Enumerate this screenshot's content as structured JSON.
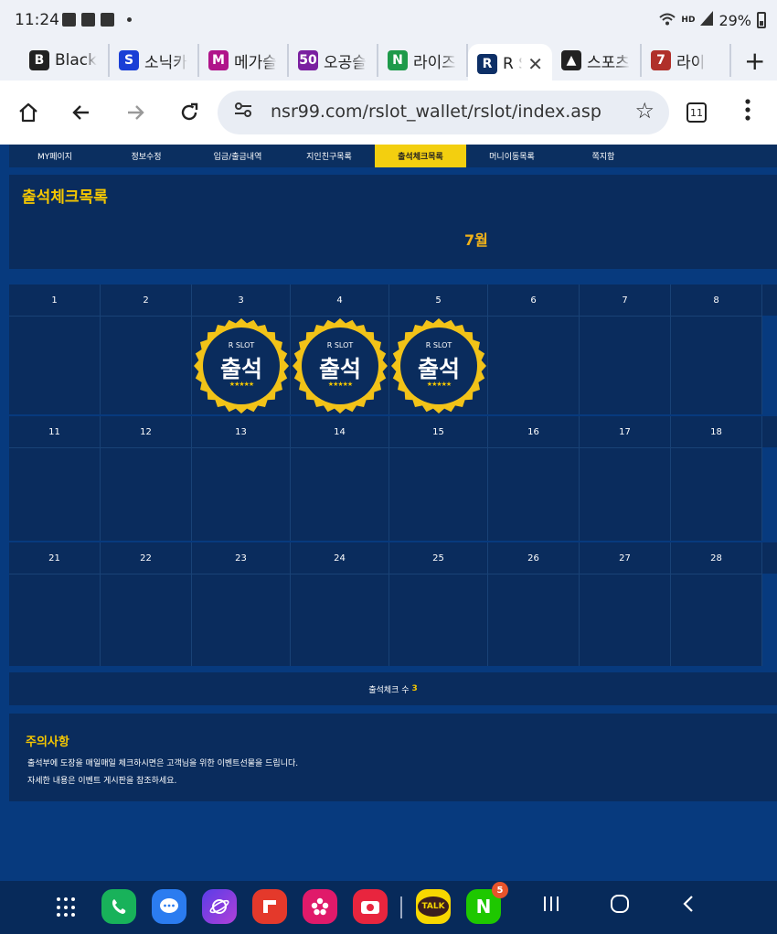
{
  "status": {
    "time": "11:24",
    "hd_label": "HD",
    "battery": "29%"
  },
  "tabs": [
    {
      "label": "Black",
      "fav": "B",
      "color": "#222222"
    },
    {
      "label": "소닉카",
      "fav": "S",
      "color": "#1a3fd6"
    },
    {
      "label": "메가슬",
      "fav": "M",
      "color": "#b0158a"
    },
    {
      "label": "오공슬",
      "fav": "50",
      "color": "#7a1fa0"
    },
    {
      "label": "라이즈",
      "fav": "N",
      "color": "#1e9a4a"
    },
    {
      "label": "R S",
      "fav": "R",
      "color": "#0d2f66",
      "active": true
    },
    {
      "label": "스포츠",
      "fav": "▲",
      "color": "#222222"
    },
    {
      "label": "라이",
      "fav": "7",
      "color": "#b0302a"
    }
  ],
  "address": {
    "url": "nsr99.com/rslot_wallet/rslot/index.asp",
    "tab_count": "11"
  },
  "subnav": [
    "MY페이지",
    "정보수정",
    "입금/출금내역",
    "지인친구목록",
    "출석체크목록",
    "머니이동목록",
    "쪽지함"
  ],
  "page": {
    "title": "출석체크목록",
    "month": "7월"
  },
  "calendar": {
    "weeks": [
      [
        "1",
        "2",
        "3",
        "4",
        "5",
        "6",
        "7",
        "8"
      ],
      [
        "11",
        "12",
        "13",
        "14",
        "15",
        "16",
        "17",
        "18"
      ],
      [
        "21",
        "22",
        "23",
        "24",
        "25",
        "26",
        "27",
        "28"
      ]
    ],
    "stamp_top": "R SLOT",
    "stamp_main": "출석",
    "stamp_stars": "★★★★★",
    "attended_days": [
      "3",
      "4",
      "5"
    ]
  },
  "count": {
    "label": "출석체크 수",
    "value": "3"
  },
  "notice": {
    "title": "주의사항",
    "lines": [
      "출석부에 도장을 매일매일 체크하시면은 고객님을 위한 이벤트선물을 드립니다.",
      "자세한 내용은 이벤트 게시판을 참조하세요."
    ]
  },
  "dock": {
    "talk_label": "TALK",
    "naver_label": "N",
    "naver_badge": "5"
  }
}
